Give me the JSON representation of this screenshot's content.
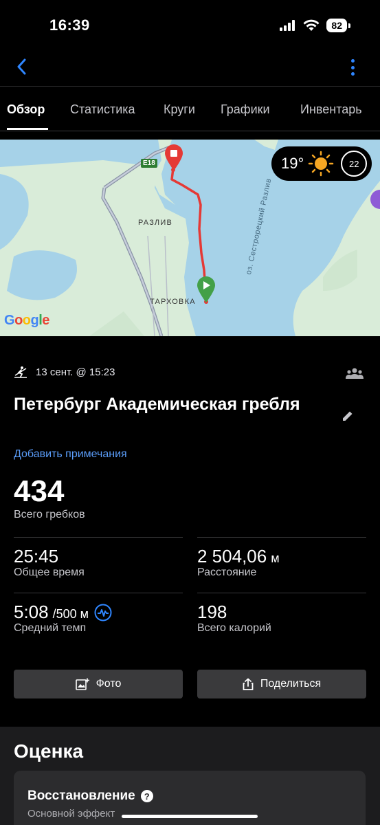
{
  "status_bar": {
    "time": "16:39",
    "battery": "82"
  },
  "tabs": [
    {
      "label": "Обзор"
    },
    {
      "label": "Статистика"
    },
    {
      "label": "Круги"
    },
    {
      "label": "Графики"
    },
    {
      "label": "Инвентарь"
    }
  ],
  "map": {
    "labels": {
      "road": "E18",
      "town1": "РАЗЛИВ",
      "town2": "ТАРХОВКА",
      "lake": "оз. Сестрорецкий Разлив"
    },
    "google": "Google",
    "weather": {
      "temp": "19°",
      "wind": "22"
    }
  },
  "activity": {
    "date": "13 сент. @ 15:23",
    "title": "Петербург Академическая гребля",
    "add_note": "Добавить примечания",
    "strokes_value": "434",
    "strokes_label": "Всего гребков"
  },
  "stats": [
    {
      "value": "25:45",
      "unit": "",
      "label": "Общее время"
    },
    {
      "value": "2 504,06",
      "unit": "м",
      "label": "Расстояние"
    },
    {
      "value": "5:08",
      "unit": "/500 м",
      "label": "Средний темп"
    },
    {
      "value": "198",
      "unit": "",
      "label": "Всего калорий"
    }
  ],
  "buttons": {
    "photo": "Фото",
    "share": "Поделиться"
  },
  "rating": {
    "title": "Оценка",
    "card_title": "Восстановление",
    "card_sub": "Основной эффект"
  },
  "colors": {
    "accent": "#2f86ff",
    "route": "#e53935",
    "start": "#43a047",
    "water": "#a6d2e8",
    "land": "#d9ecd9"
  }
}
